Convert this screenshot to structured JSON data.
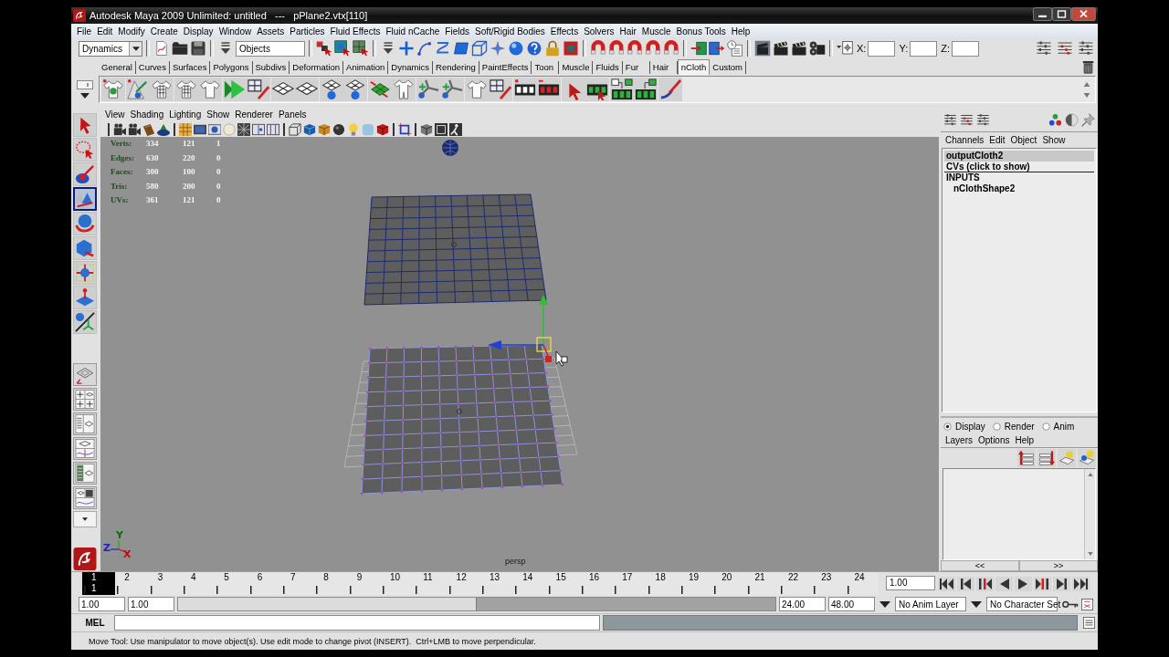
{
  "window": {
    "title": "Autodesk Maya 2009 Unlimited: untitled   ---   pPlane2.vtx[110]"
  },
  "menu_bar": [
    "File",
    "Edit",
    "Modify",
    "Create",
    "Display",
    "Window",
    "Assets",
    "Particles",
    "Fluid Effects",
    "Fluid nCache",
    "Fields",
    "Soft/Rigid Bodies",
    "Effects",
    "Solvers",
    "Hair",
    "Muscle",
    "Bonus Tools",
    "Help"
  ],
  "status_line": {
    "menu_set": "Dynamics",
    "selection_field": "Objects",
    "coordinate_fields": [
      "X:",
      "Y:",
      "Z:"
    ]
  },
  "shelf": {
    "tabs": [
      {
        "label": "General",
        "selected": false
      },
      {
        "label": "Curves",
        "selected": false
      },
      {
        "label": "Surfaces",
        "selected": false
      },
      {
        "label": "Polygons",
        "selected": false
      },
      {
        "label": "Subdivs",
        "selected": false
      },
      {
        "label": "Deformation",
        "selected": false
      },
      {
        "label": "Animation",
        "selected": false
      },
      {
        "label": "Dynamics",
        "selected": false
      },
      {
        "label": "Rendering",
        "selected": false
      },
      {
        "label": "PaintEffects",
        "selected": false
      },
      {
        "label": "Toon",
        "selected": false
      },
      {
        "label": "Muscle",
        "selected": false
      },
      {
        "label": "Fluids",
        "selected": false
      },
      {
        "label": "Fur",
        "selected": false
      },
      {
        "label": "Hair",
        "selected": false
      },
      {
        "label": "nCloth",
        "selected": true
      },
      {
        "label": "Custom",
        "selected": false
      }
    ]
  },
  "toolbox": {
    "tools": [
      {
        "selected": false
      },
      {
        "selected": false
      },
      {
        "selected": false
      },
      {
        "selected": true
      },
      {
        "selected": false
      },
      {
        "selected": false
      },
      {
        "selected": false
      },
      {
        "selected": false
      },
      {
        "selected": false
      }
    ]
  },
  "viewport": {
    "menu": [
      "View",
      "Shading",
      "Lighting",
      "Show",
      "Renderer",
      "Panels"
    ],
    "hud": [
      {
        "label": "Verts:",
        "values": [
          "334",
          "121",
          "1"
        ]
      },
      {
        "label": "Edges:",
        "values": [
          "630",
          "220",
          "0"
        ]
      },
      {
        "label": "Faces:",
        "values": [
          "300",
          "100",
          "0"
        ]
      },
      {
        "label": "Tris:",
        "values": [
          "580",
          "200",
          "0"
        ]
      },
      {
        "label": "UVs:",
        "values": [
          "361",
          "121",
          "0"
        ]
      }
    ],
    "axis_labels": [
      {
        "label": "Y",
        "color": "#0c6e0c"
      },
      {
        "label": "Z",
        "color": "#1a22c8"
      },
      {
        "label": "X",
        "color": "#b80e0e"
      }
    ],
    "camera": "persp"
  },
  "channel_box": {
    "menu": [
      "Channels",
      "Edit",
      "Object",
      "Show"
    ],
    "object": "outputCloth2",
    "cvs_label": "CVs (click to show)",
    "inputs_header": "INPUTS",
    "inputs": [
      "nClothShape2"
    ]
  },
  "layer_editor": {
    "modes": [
      {
        "label": "Display",
        "selected": true
      },
      {
        "label": "Render",
        "selected": false
      },
      {
        "label": "Anim",
        "selected": false
      }
    ],
    "menu": [
      "Layers",
      "Options",
      "Help"
    ],
    "page_buttons": [
      "<<",
      ">>"
    ]
  },
  "time_slider": {
    "frames": [
      {
        "label": "1",
        "selected": true
      },
      {
        "label": "2",
        "selected": false
      },
      {
        "label": "3",
        "selected": false
      },
      {
        "label": "4",
        "selected": false
      },
      {
        "label": "5",
        "selected": false
      },
      {
        "label": "6",
        "selected": false
      },
      {
        "label": "7",
        "selected": false
      },
      {
        "label": "8",
        "selected": false
      },
      {
        "label": "9",
        "selected": false
      },
      {
        "label": "10",
        "selected": false
      },
      {
        "label": "11",
        "selected": false
      },
      {
        "label": "12",
        "selected": false
      },
      {
        "label": "13",
        "selected": false
      },
      {
        "label": "14",
        "selected": false
      },
      {
        "label": "15",
        "selected": false
      },
      {
        "label": "16",
        "selected": false
      },
      {
        "label": "17",
        "selected": false
      },
      {
        "label": "18",
        "selected": false
      },
      {
        "label": "19",
        "selected": false
      },
      {
        "label": "20",
        "selected": false
      },
      {
        "label": "21",
        "selected": false
      },
      {
        "label": "22",
        "selected": false
      },
      {
        "label": "23",
        "selected": false
      },
      {
        "label": "24",
        "selected": false
      }
    ],
    "current_frame": "1",
    "current_time": "1.00"
  },
  "range_slider": {
    "start_time": "1.00",
    "playback_start": "1.00",
    "level": 0.5,
    "playback_end": "24.00",
    "end_time": "48.00",
    "anim_layer": "No Anim Layer",
    "character_set": "No Character Set"
  },
  "command_line": {
    "language": "MEL"
  },
  "help_line": "Move Tool: Use manipulator to move object(s). Use edit mode to change pivot (INSERT).  Ctrl+LMB to move perpendicular."
}
